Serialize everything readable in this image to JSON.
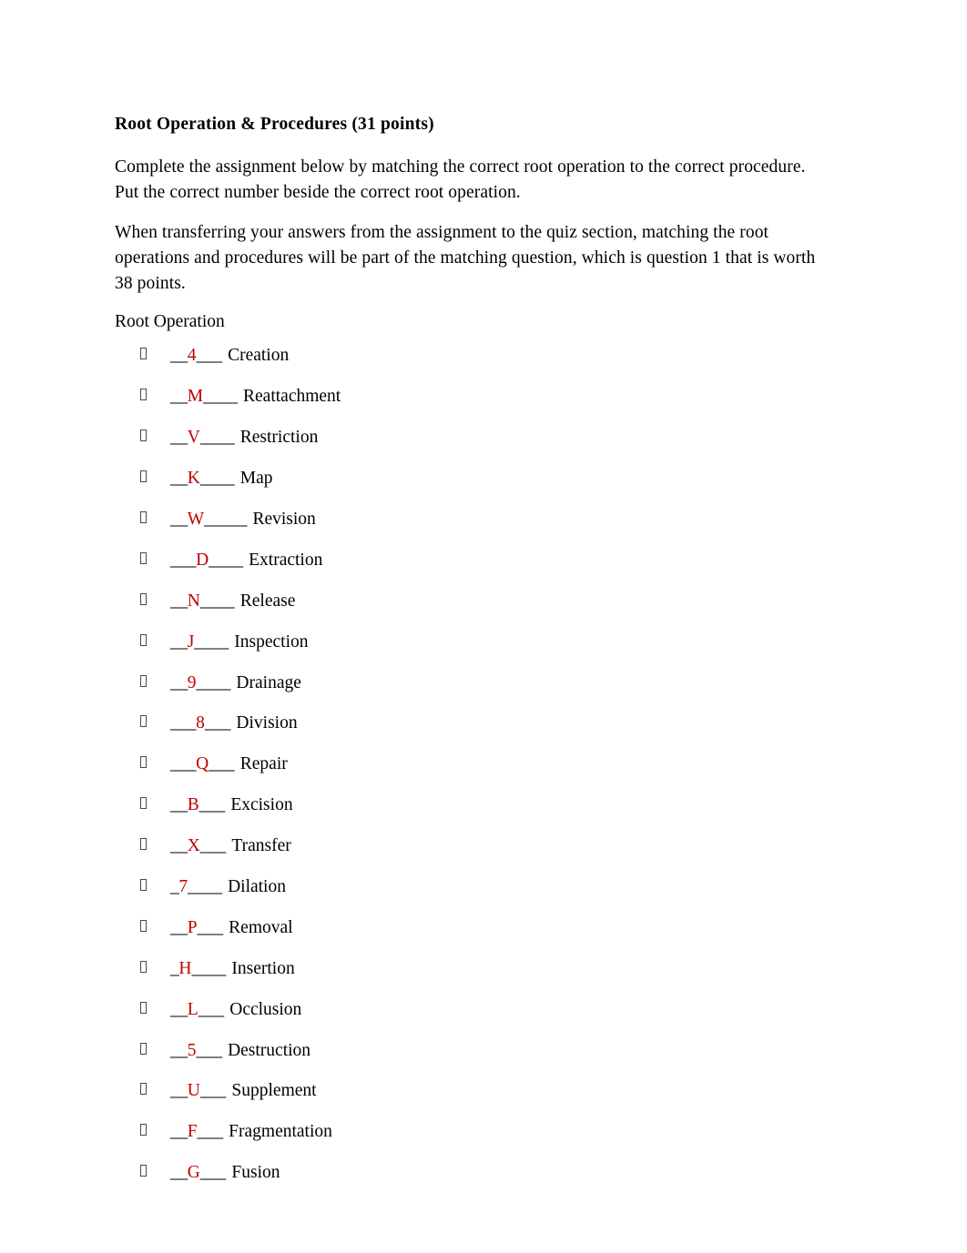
{
  "document": {
    "title": "Root Operation & Procedures (31 points)",
    "paragraphs": [
      "Complete the assignment below by matching the correct root operation to the correct procedure. Put the correct number beside the correct root operation.",
      "When transferring your answers from the assignment to the quiz section, matching the root operations and procedures will be part of the matching question, which is question 1 that is worth 38 points."
    ],
    "section_label": "Root Operation",
    "answer_color": "#c00000",
    "text_color": "#000000",
    "background_color": "#ffffff",
    "bullet_glyph": "missing-glyph-box",
    "items": [
      {
        "prefix": "__",
        "answer": "4",
        "suffix": "___ ",
        "name": "Creation"
      },
      {
        "prefix": "__",
        "answer": "M",
        "suffix": "____ ",
        "name": "Reattachment"
      },
      {
        "prefix": "__",
        "answer": "V",
        "suffix": "____ ",
        "name": "Restriction"
      },
      {
        "prefix": "__",
        "answer": "K",
        "suffix": "____ ",
        "name": "Map"
      },
      {
        "prefix": "__",
        "answer": "W",
        "suffix": "_____ ",
        "name": "Revision"
      },
      {
        "prefix": "___",
        "answer": "D",
        "suffix": "____ ",
        "name": "Extraction"
      },
      {
        "prefix": "__",
        "answer": "N",
        "suffix": "____ ",
        "name": "Release"
      },
      {
        "prefix": "__",
        "answer": "J",
        "suffix": "____ ",
        "name": "Inspection"
      },
      {
        "prefix": "__",
        "answer": "9",
        "suffix": "____ ",
        "name": "Drainage"
      },
      {
        "prefix": "___",
        "answer": "8",
        "suffix": "___ ",
        "name": "Division"
      },
      {
        "prefix": "___",
        "answer": "Q",
        "suffix": "___ ",
        "name": "Repair"
      },
      {
        "prefix": "__",
        "answer": "B",
        "suffix": "___ ",
        "name": "Excision"
      },
      {
        "prefix": "__",
        "answer": "X",
        "suffix": "___ ",
        "name": "Transfer"
      },
      {
        "prefix": "_",
        "answer": "7",
        "suffix": "____ ",
        "name": "Dilation"
      },
      {
        "prefix": "__",
        "answer": "P",
        "suffix": "___ ",
        "name": "Removal"
      },
      {
        "prefix": "_",
        "answer": "H",
        "suffix": "____ ",
        "name": "Insertion"
      },
      {
        "prefix": "__",
        "answer": "L",
        "suffix": "___ ",
        "name": "Occlusion"
      },
      {
        "prefix": "__",
        "answer": "5",
        "suffix": "___ ",
        "name": "Destruction"
      },
      {
        "prefix": "__",
        "answer": "U",
        "suffix": "___ ",
        "name": "Supplement"
      },
      {
        "prefix": "__",
        "answer": "F",
        "suffix": "___ ",
        "name": "Fragmentation"
      },
      {
        "prefix": "__",
        "answer": "G",
        "suffix": "___ ",
        "name": "Fusion"
      }
    ]
  }
}
